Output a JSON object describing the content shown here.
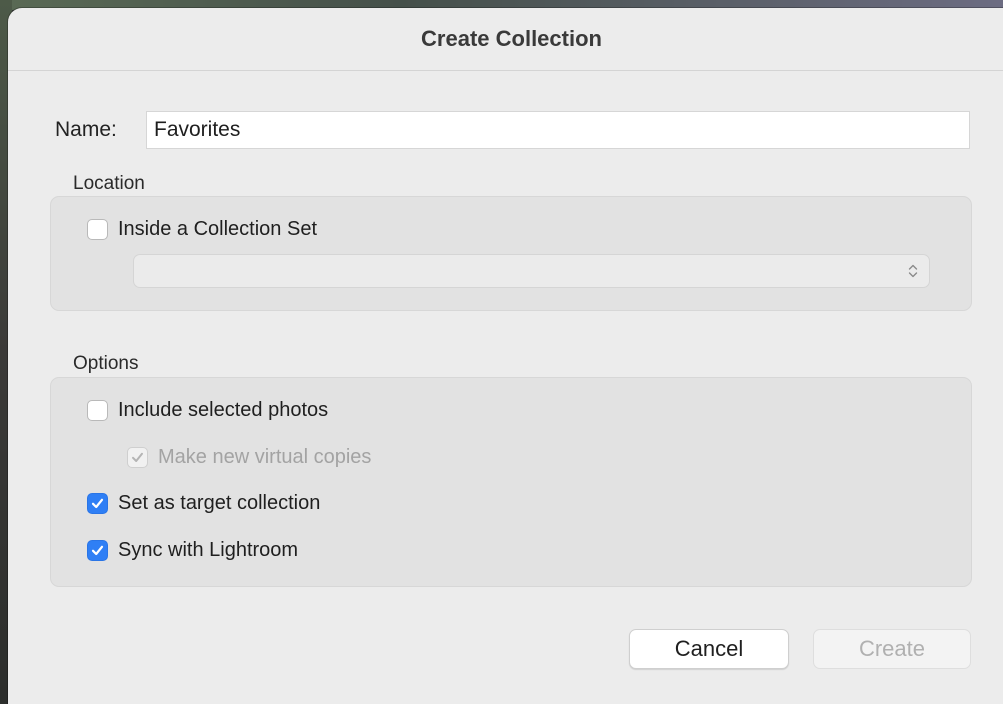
{
  "dialog": {
    "title": "Create Collection"
  },
  "name_field": {
    "label": "Name:",
    "value": "Favorites"
  },
  "location": {
    "heading": "Location",
    "inside_collection_set": {
      "label": "Inside a Collection Set",
      "checked": false
    },
    "collection_set_select": {
      "selected": ""
    }
  },
  "options": {
    "heading": "Options",
    "include_selected_photos": {
      "label": "Include selected photos",
      "checked": false
    },
    "make_new_virtual_copies": {
      "label": "Make new virtual copies",
      "checked": true,
      "enabled": false
    },
    "set_as_target_collection": {
      "label": "Set as target collection",
      "checked": true
    },
    "sync_with_lightroom": {
      "label": "Sync with Lightroom",
      "checked": true
    }
  },
  "buttons": {
    "cancel": "Cancel",
    "create": "Create"
  },
  "colors": {
    "accent": "#2f7ff5",
    "dialog_background": "#ececec",
    "group_background": "#e2e2e2"
  }
}
